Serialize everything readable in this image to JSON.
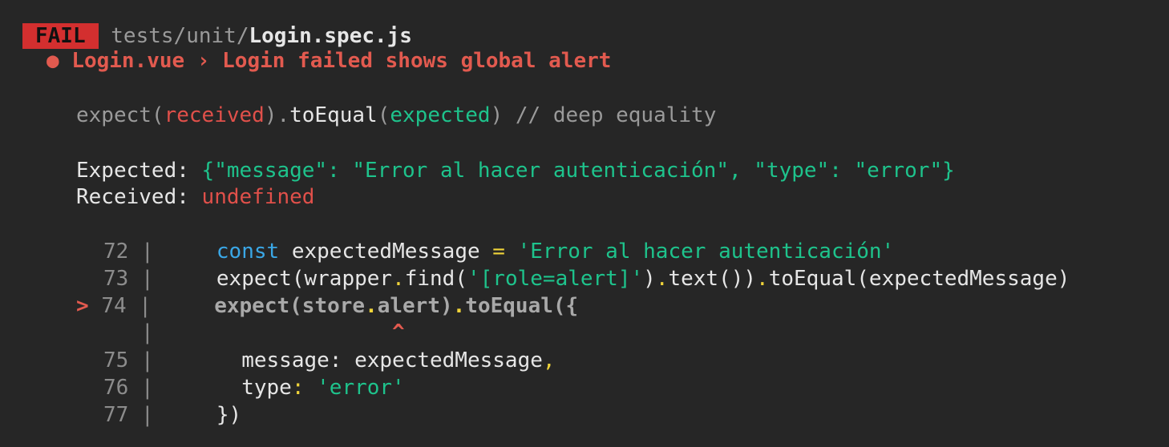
{
  "header": {
    "status_badge": "FAIL",
    "path_prefix": "tests/unit/",
    "file_name": "Login.spec.js"
  },
  "test": {
    "bullet": "●",
    "title": "Login.vue › Login failed shows global alert"
  },
  "matcher": {
    "expect_open": "expect(",
    "received": "received",
    "mid": ").",
    "method": "toEqual",
    "paren_open": "(",
    "expected": "expected",
    "comment": ") // deep equality"
  },
  "result": {
    "expected_label": "Expected: ",
    "expected_value": "{\"message\": \"Error al hacer autenticación\", \"type\": \"error\"}",
    "received_label": "Received: ",
    "received_value": "undefined"
  },
  "code_frame": {
    "pointer": ">",
    "bar": "|",
    "caret": "^",
    "line72": {
      "num": "72",
      "keyword": "const",
      "text": " expectedMessage ",
      "eq": "=",
      "string": "'Error al hacer autenticación'"
    },
    "line73": {
      "num": "73",
      "p1": "expect(wrapper",
      "p2": "find(",
      "p3": "'[role=alert]'",
      "p4": ")",
      "p5": "text())",
      "p6": "toEqual(expectedMessage)"
    },
    "line74": {
      "num": "74",
      "p1": "expect(store",
      "p2": "alert)",
      "p3": "toEqual({"
    },
    "line75": {
      "num": "75",
      "text": "message: expectedMessage",
      "comma": ","
    },
    "line76": {
      "num": "76",
      "key": "type",
      "colon": ": ",
      "value": "'error'"
    },
    "line77": {
      "num": "77",
      "text": "})"
    }
  },
  "colors": {
    "background": "#262626",
    "fail_badge": "#d32f2f",
    "error_red": "#e25a4f",
    "green": "#1ec38c",
    "keyword_blue": "#3aa7e6",
    "dot_yellow": "#f0d43a"
  }
}
